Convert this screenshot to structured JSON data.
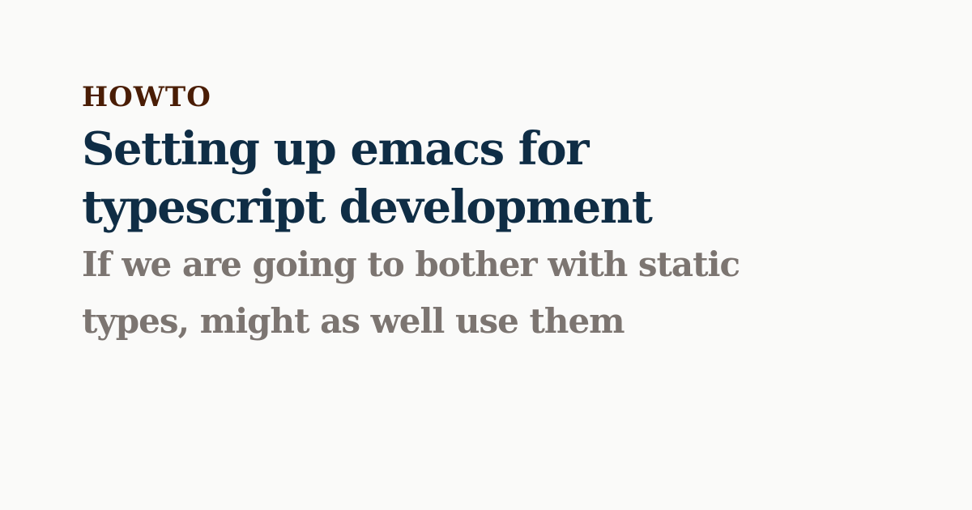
{
  "card": {
    "category": "HOWTO",
    "title_line1": "Setting up emacs for",
    "title_line2": "typescript development",
    "subtitle_line1": "If we are going to bother with static",
    "subtitle_line2": "types, might as well use them"
  },
  "colors": {
    "background": "#fafaf9",
    "category": "#4a1d05",
    "title": "#0f2d45",
    "subtitle": "#7c7571"
  }
}
